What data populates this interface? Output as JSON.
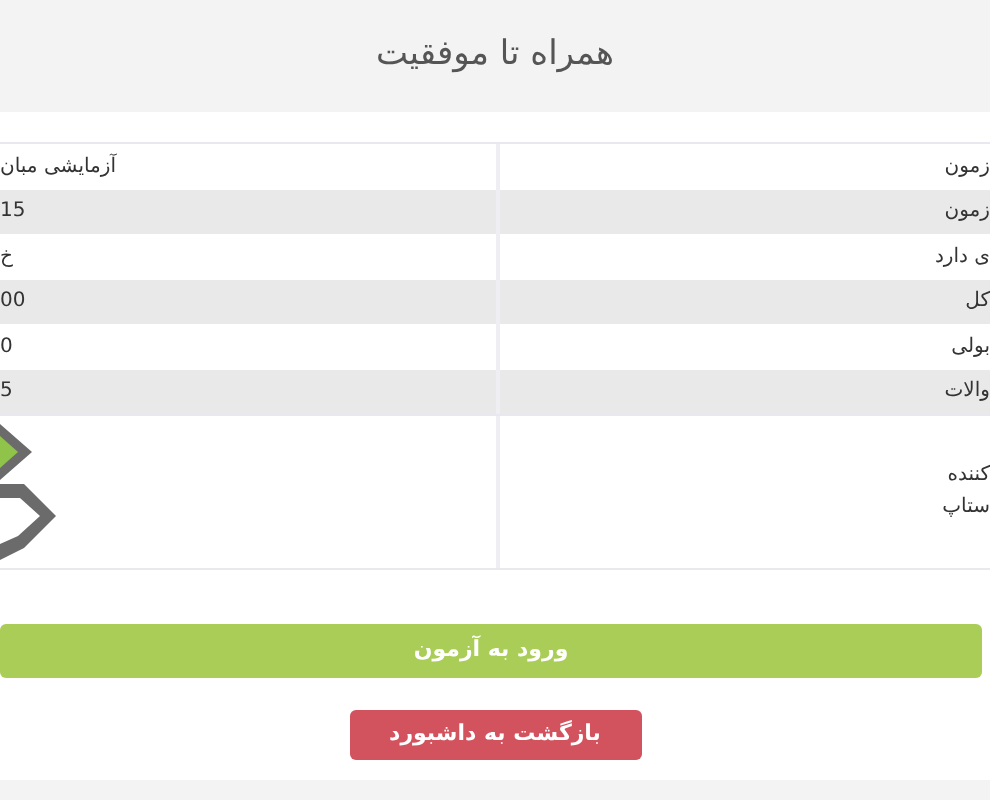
{
  "title": "همراه تا موفقیت",
  "rows": [
    {
      "label": "زمون",
      "value": "آزمایشی مبان"
    },
    {
      "label": "زمون",
      "value": "15"
    },
    {
      "label": "ی دارد",
      "value": "خ"
    },
    {
      "label": "کل",
      "value": "00"
    },
    {
      "label": "بولی",
      "value": "0"
    },
    {
      "label": "والات",
      "value": "5"
    }
  ],
  "organizer": {
    "label_lines": [
      "کننده",
      "ستاپ"
    ]
  },
  "buttons": [
    {
      "label": "ورود به آزمون",
      "kind": "primary"
    },
    {
      "label": "بازگشت به داشبورد",
      "kind": "danger"
    }
  ]
}
